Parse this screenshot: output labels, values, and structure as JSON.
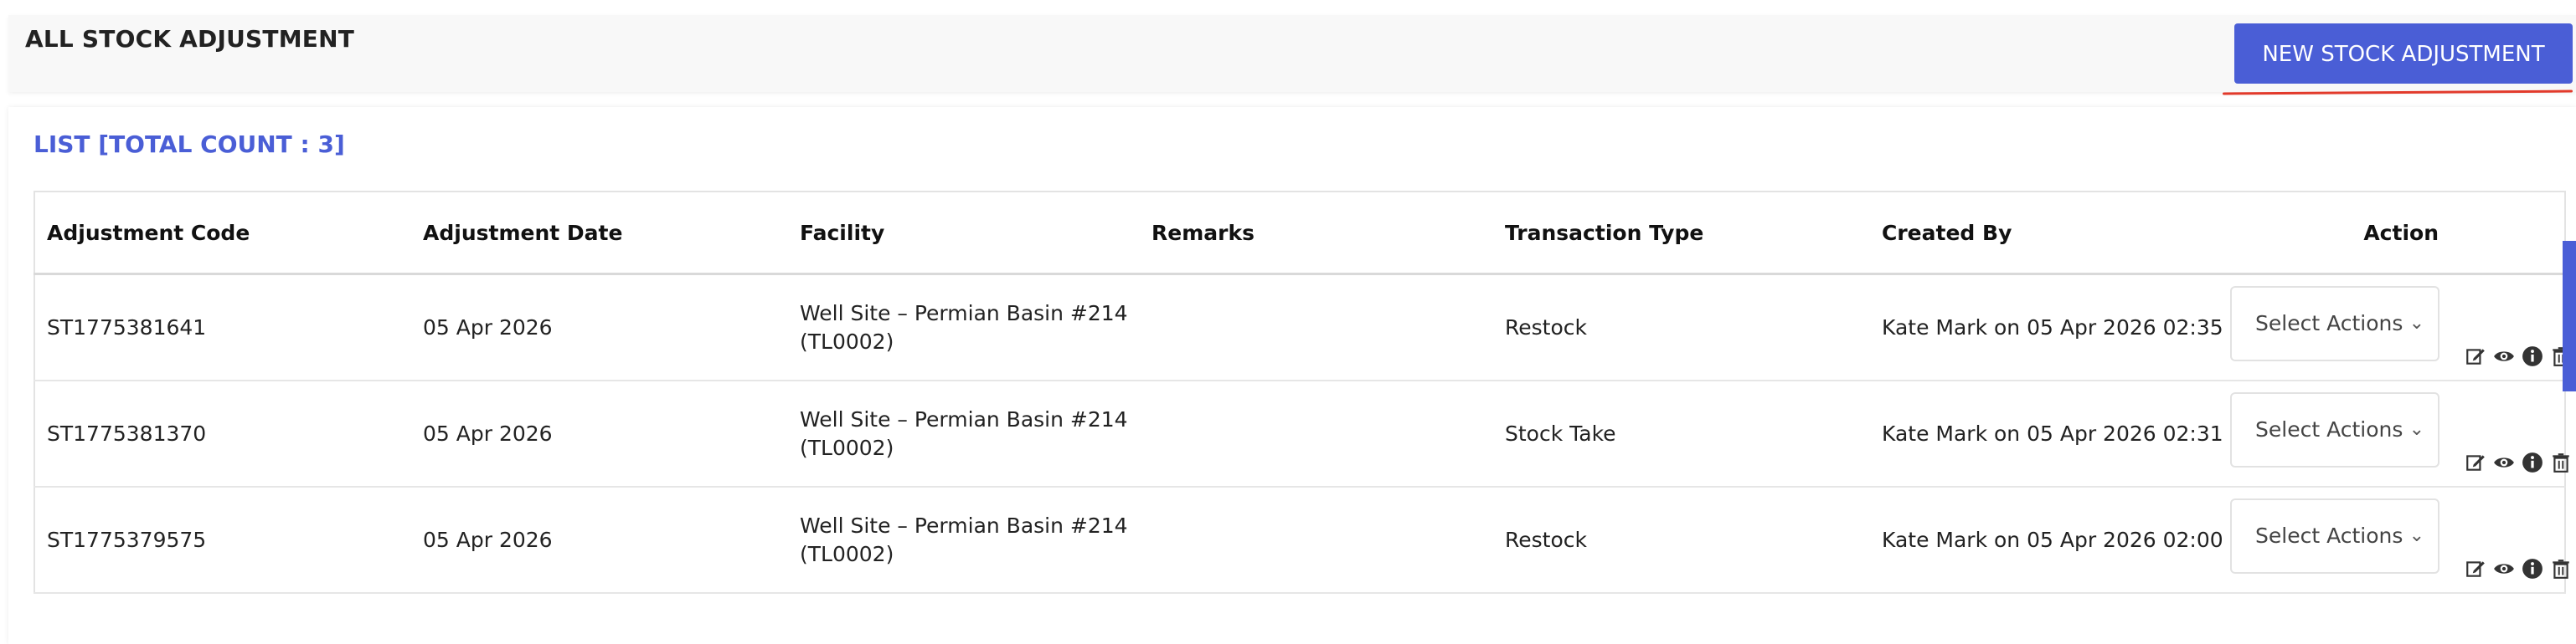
{
  "header": {
    "title": "ALL STOCK ADJUSTMENT",
    "new_button": "NEW STOCK ADJUSTMENT"
  },
  "list": {
    "title": "LIST [TOTAL COUNT : 3]",
    "columns": [
      "Adjustment Code",
      "Adjustment Date",
      "Facility",
      "Remarks",
      "Transaction Type",
      "Created By",
      "Action"
    ],
    "rows": [
      {
        "code": "ST1775381641",
        "date": "05 Apr 2026",
        "facility_line1": "Well Site – Permian Basin #214",
        "facility_line2": "(TL0002)",
        "remarks": "",
        "type": "Restock",
        "created_by": "Kate Mark on 05 Apr 2026 02:35",
        "action_select": "Select Actions"
      },
      {
        "code": "ST1775381370",
        "date": "05 Apr 2026",
        "facility_line1": "Well Site – Permian Basin #214",
        "facility_line2": "(TL0002)",
        "remarks": "",
        "type": "Stock Take",
        "created_by": "Kate Mark on 05 Apr 2026 02:31",
        "action_select": "Select Actions"
      },
      {
        "code": "ST1775379575",
        "date": "05 Apr 2026",
        "facility_line1": "Well Site – Permian Basin #214",
        "facility_line2": "(TL0002)",
        "remarks": "",
        "type": "Restock",
        "created_by": "Kate Mark on 05 Apr 2026 02:00",
        "action_select": "Select Actions"
      }
    ]
  },
  "icons": {
    "row_actions": [
      "edit-icon",
      "view-icon",
      "info-icon",
      "delete-icon"
    ],
    "select": "chevron-down-icon"
  },
  "colors": {
    "accent": "#4a5ed6",
    "underline": "#e23a2b"
  }
}
